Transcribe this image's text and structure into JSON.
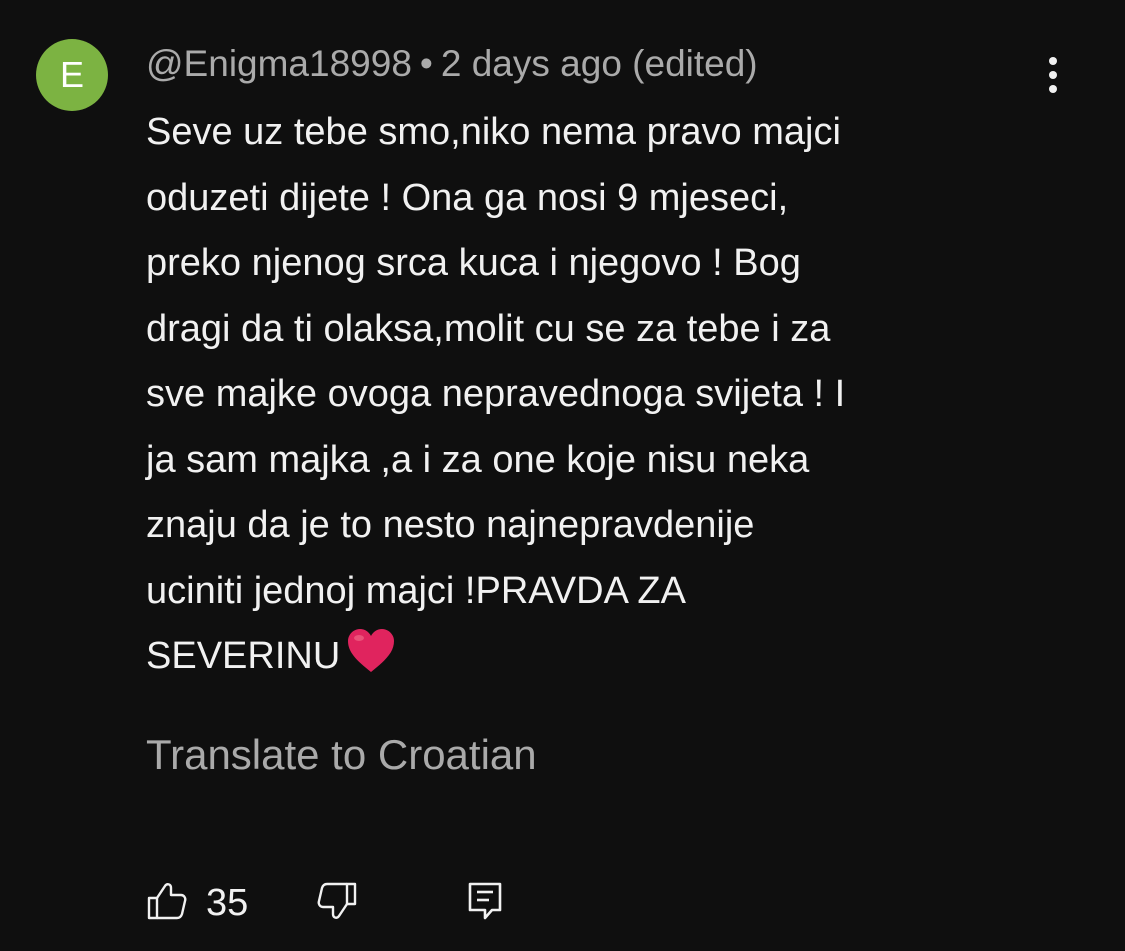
{
  "comment": {
    "avatar_initial": "E",
    "avatar_color": "#7cb342",
    "author": "@Enigma18998",
    "separator": "•",
    "time": "2 days ago (edited)",
    "text": "Seve uz tebe smo,niko nema pravo majci\noduzeti dijete ! Ona ga nosi 9 mjeseci,\npreko njenog srca kuca i njegovo ! Bog\ndragi da ti olaksa,molit cu se za tebe i za\nsve majke ovoga nepravednoga svijeta ! I\nja sam majka ,a i za one koje nisu neka\nznaju da je to nesto najnepravdenije\nuciniti jednoj majci !PRAVDA ZA\nSEVERINU",
    "translate_label": "Translate to Croatian",
    "like_count": "35"
  },
  "icons": {
    "more": "more-vertical-icon",
    "heart": "red-heart-emoji-icon",
    "like": "thumbs-up-icon",
    "dislike": "thumbs-down-icon",
    "reply": "comment-reply-icon"
  },
  "colors": {
    "background": "#0f0f0f",
    "primary_text": "#f1f1f1",
    "secondary_text": "#aaaaaa",
    "heart": "#e0245e"
  }
}
